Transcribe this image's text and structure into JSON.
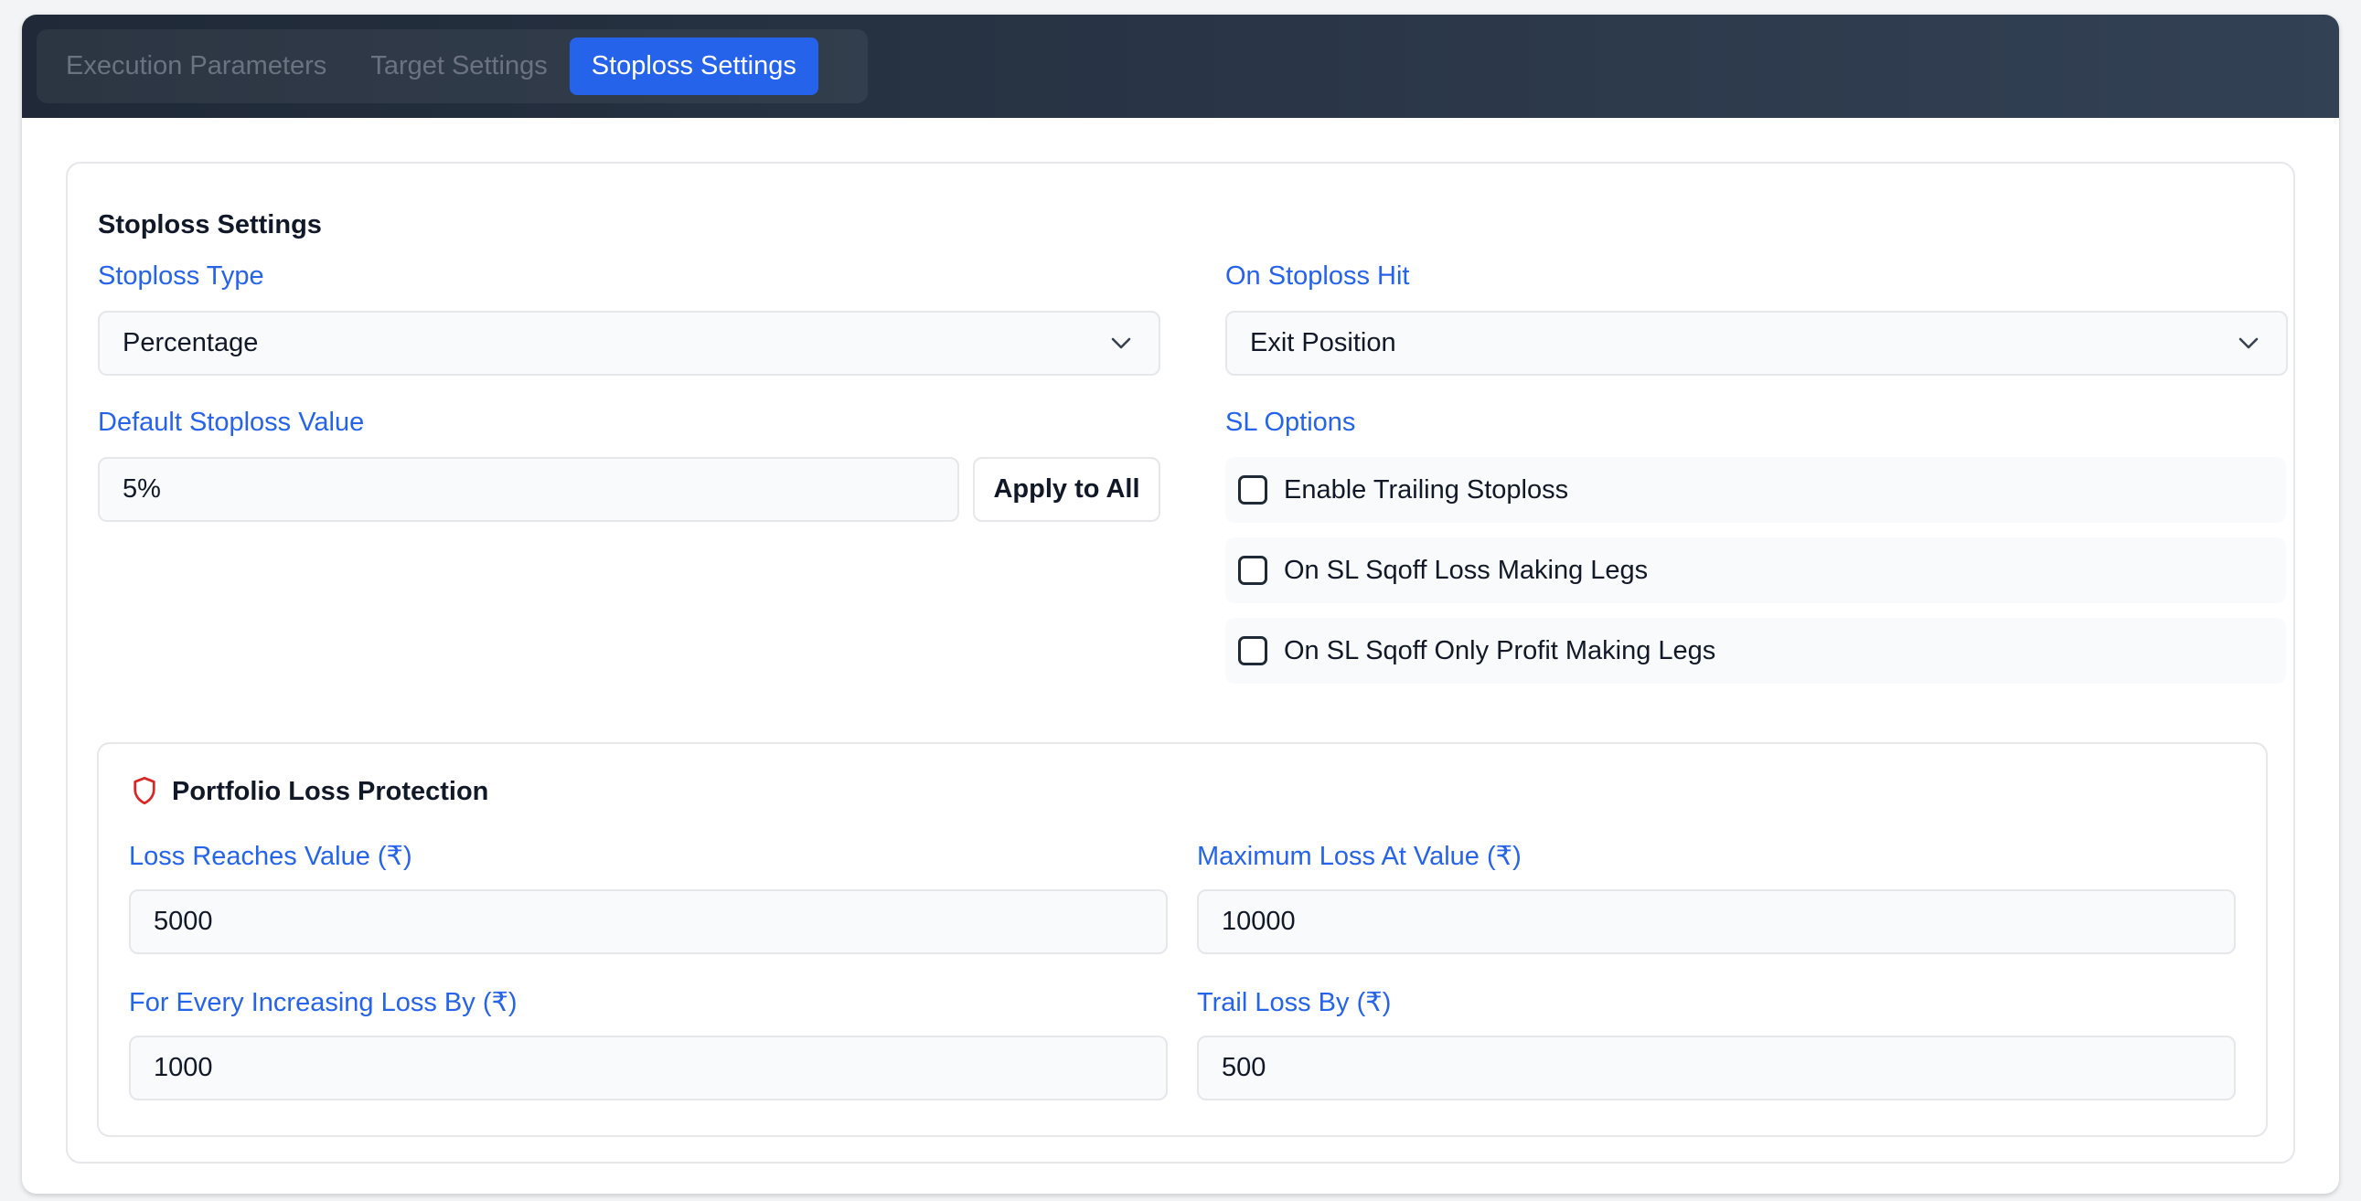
{
  "tabs": [
    {
      "label": "Execution Parameters",
      "active": false
    },
    {
      "label": "Target Settings",
      "active": false
    },
    {
      "label": "Stoploss Settings",
      "active": true
    }
  ],
  "stoploss": {
    "title": "Stoploss Settings",
    "type_label": "Stoploss Type",
    "type_value": "Percentage",
    "hit_label": "On Stoploss Hit",
    "hit_value": "Exit Position",
    "default_label": "Default Stoploss Value",
    "default_value": "5%",
    "apply_label": "Apply to All",
    "options_label": "SL Options",
    "options": [
      {
        "label": "Enable Trailing Stoploss",
        "checked": false
      },
      {
        "label": "On SL Sqoff Loss Making Legs",
        "checked": false
      },
      {
        "label": "On SL Sqoff Only Profit Making Legs",
        "checked": false
      }
    ]
  },
  "protection": {
    "title": "Portfolio Loss Protection",
    "icon": "shield-icon",
    "loss_reaches_label": "Loss Reaches Value (₹)",
    "loss_reaches_value": "5000",
    "max_loss_label": "Maximum Loss At Value (₹)",
    "max_loss_value": "10000",
    "every_increase_label": "For Every Increasing Loss By (₹)",
    "every_increase_value": "1000",
    "trail_label": "Trail Loss By (₹)",
    "trail_value": "500"
  },
  "colors": {
    "accent": "#2563eb",
    "header_start": "#1f2937",
    "header_end": "#334155",
    "shield": "#dc2626"
  }
}
